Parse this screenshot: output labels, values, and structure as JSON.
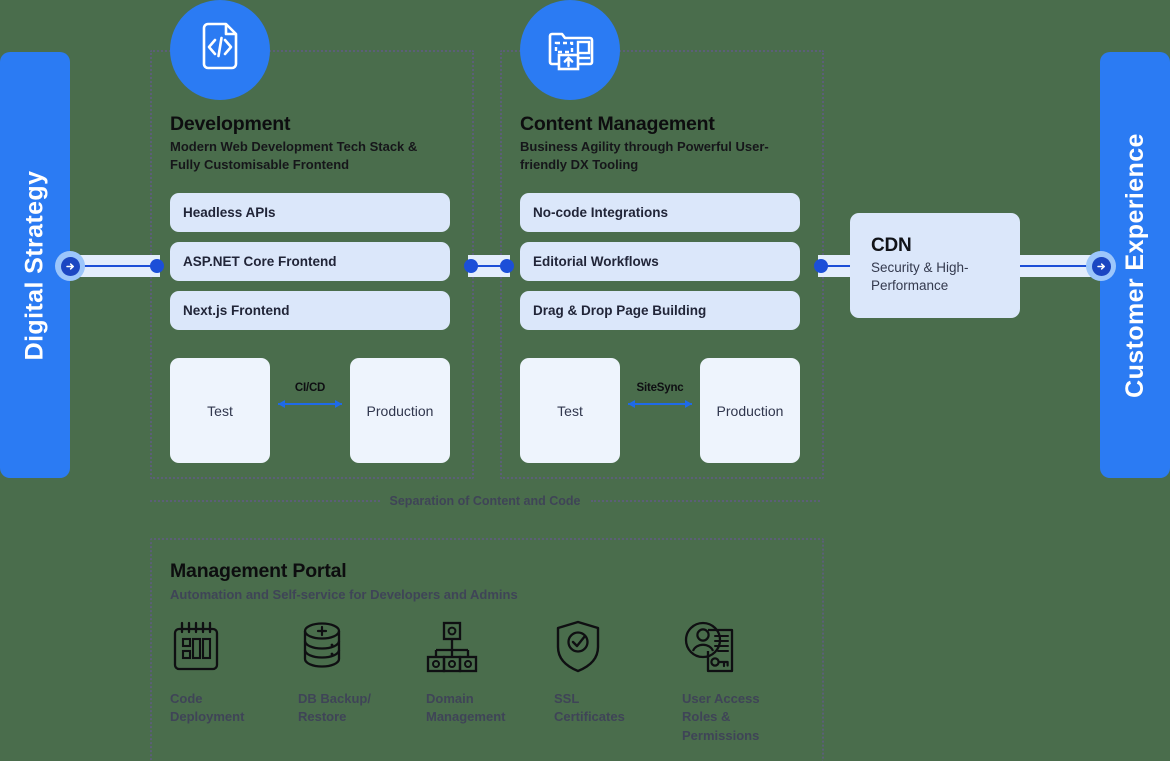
{
  "left_bar": {
    "label": "Digital Strategy",
    "color": "#2b7bf3"
  },
  "right_bar": {
    "label": "Customer Experience",
    "color": "#2b7bf3"
  },
  "development": {
    "icon": "code-file-icon",
    "title": "Development",
    "subtitle": "Modern Web Development Tech Stack & Fully Customisable Frontend",
    "features": [
      "Headless APIs",
      "ASP.NET Core Frontend",
      "Next.js Frontend"
    ],
    "environments": {
      "left": "Test",
      "right": "Production",
      "arrow_label": "CI/CD"
    }
  },
  "content_management": {
    "icon": "page-builder-icon",
    "title": "Content Management",
    "subtitle": "Business Agility through Powerful User-friendly DX Tooling",
    "features": [
      "No-code Integrations",
      "Editorial Workflows",
      "Drag & Drop Page Building"
    ],
    "environments": {
      "left": "Test",
      "right": "Production",
      "arrow_label": "SiteSync"
    }
  },
  "separation_label": "Separation of Content and Code",
  "cdn": {
    "title": "CDN",
    "subtitle": "Security & High-Performance"
  },
  "management_portal": {
    "title": "Management Portal",
    "subtitle": "Automation and Self-service for Developers and Admins",
    "items": [
      {
        "icon": "code-deployment-icon",
        "label": "Code Deployment"
      },
      {
        "icon": "database-backup-icon",
        "label": "DB Backup/ Restore"
      },
      {
        "icon": "domain-hierarchy-icon",
        "label": "Domain Management"
      },
      {
        "icon": "shield-check-icon",
        "label": "SSL Certificates"
      },
      {
        "icon": "user-access-key-icon",
        "label": "User Access Roles & Permissions"
      }
    ]
  },
  "colors": {
    "brand_blue": "#2b7bf3",
    "deep_blue": "#1c4fd8",
    "pill_bg": "#dbe7fa",
    "env_bg": "#eef4fd",
    "text_dark": "#212538",
    "muted": "#3f4457",
    "background": "#4a6d4c"
  }
}
